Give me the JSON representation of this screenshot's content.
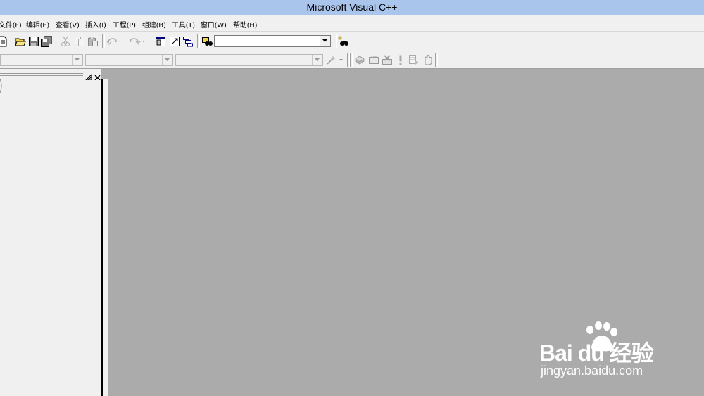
{
  "window": {
    "title": "Microsoft Visual C++"
  },
  "menu": {
    "items": [
      {
        "label": "文件(F)"
      },
      {
        "label": "编辑(E)"
      },
      {
        "label": "查看(V)"
      },
      {
        "label": "插入(I)"
      },
      {
        "label": "工程(P)"
      },
      {
        "label": "组建(B)"
      },
      {
        "label": "工具(T)"
      },
      {
        "label": "窗口(W)"
      },
      {
        "label": "帮助(H)"
      }
    ]
  },
  "toolbar": {
    "find_combo_value": "",
    "icons": [
      "new-text-file-icon",
      "open-folder-icon",
      "save-icon",
      "save-all-icon",
      "cut-icon",
      "copy-icon",
      "paste-icon",
      "undo-icon",
      "redo-icon",
      "workspace-icon",
      "output-icon",
      "window-list-icon",
      "find-in-files-icon",
      "search-binoculars-icon"
    ]
  },
  "wizardbar": {
    "class_combo_value": "",
    "filter_combo_value": "",
    "members_combo_value": "",
    "build_icons": [
      "compile-icon",
      "build-icon",
      "stop-build-icon",
      "execute-icon",
      "go-icon",
      "insert-breakpoint-icon"
    ]
  },
  "watermark": {
    "brand": "Bai du 经验",
    "url": "jingyan.baidu.com"
  }
}
